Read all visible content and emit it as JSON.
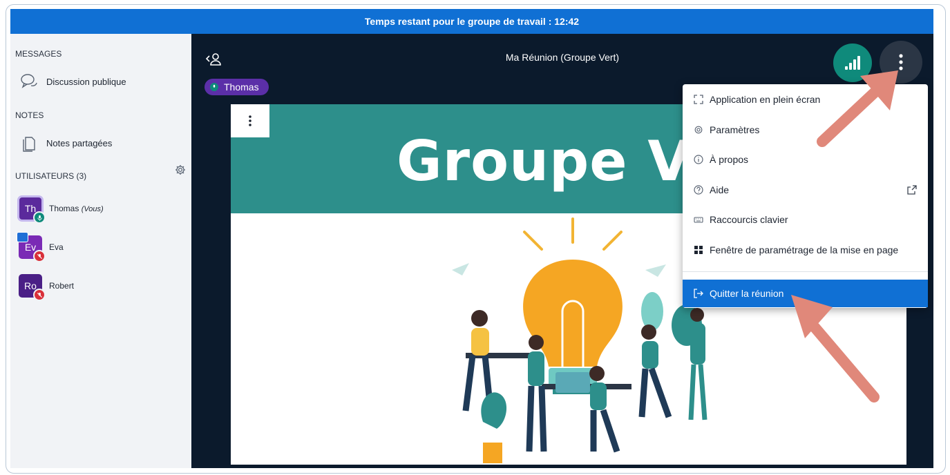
{
  "timer_banner": "Temps restant pour le groupe de travail : 12:42",
  "sidebar": {
    "messages_title": "MESSAGES",
    "public_chat": "Discussion publique",
    "notes_title": "NOTES",
    "shared_notes": "Notes partagées",
    "users_title": "UTILISATEURS (3)",
    "users": [
      {
        "initials": "Th",
        "name": "Thomas",
        "suffix": "(Vous)"
      },
      {
        "initials": "Ev",
        "name": "Eva"
      },
      {
        "initials": "Ro",
        "name": "Robert"
      }
    ]
  },
  "main": {
    "meeting_title": "Ma Réunion (Groupe Vert)",
    "talker": "Thomas",
    "slide_title": "Groupe Vert"
  },
  "menu": {
    "items": [
      {
        "label": "Application en plein écran",
        "icon": "fullscreen-icon"
      },
      {
        "label": "Paramètres",
        "icon": "gear-icon"
      },
      {
        "label": "À propos",
        "icon": "info-icon"
      },
      {
        "label": "Aide",
        "icon": "help-icon"
      },
      {
        "label": "Raccourcis clavier",
        "icon": "keyboard-icon"
      },
      {
        "label": "Fenêtre de paramétrage de la mise en page",
        "icon": "layout-icon"
      },
      {
        "label": "Quitter la réunion",
        "icon": "logout-icon"
      }
    ]
  },
  "colors": {
    "banner": "#1070d4",
    "main_bg": "#0b1a2c",
    "slide_header": "#2d8f8b",
    "accent_teal": "#0f8a7b",
    "active_item": "#1070d4",
    "arrow": "#e0887a"
  }
}
